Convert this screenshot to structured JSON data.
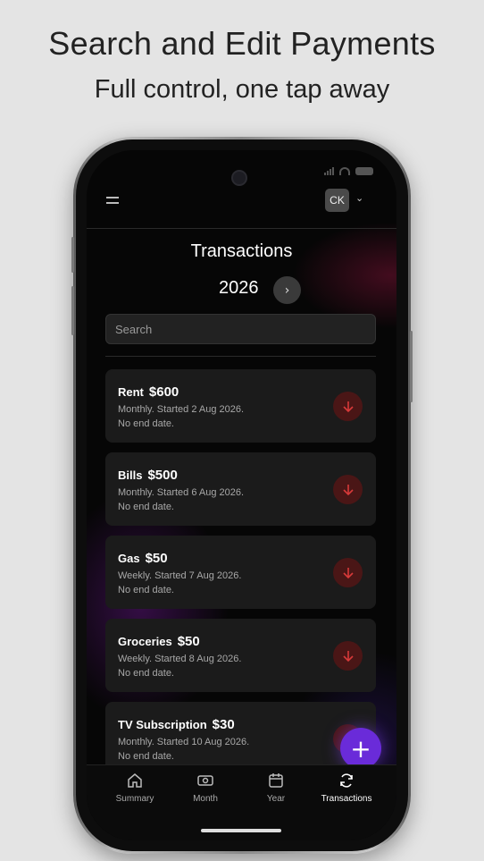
{
  "promo": {
    "headline": "Search and Edit Payments",
    "subheadline": "Full control, one tap away"
  },
  "header": {
    "menu_icon": "hamburger-icon",
    "avatar_initials": "CK",
    "avatar_chevron": "⌄"
  },
  "page": {
    "title": "Transactions",
    "year": "2026",
    "next_icon": "›"
  },
  "search": {
    "placeholder": "Search"
  },
  "transactions": [
    {
      "name": "Rent",
      "amount": "$600",
      "line1": "Monthly. Started 2 Aug 2026.",
      "line2": "No end date.",
      "icon": "arrow-down-icon"
    },
    {
      "name": "Bills",
      "amount": "$500",
      "line1": "Monthly. Started 6 Aug 2026.",
      "line2": "No end date.",
      "icon": "arrow-down-icon"
    },
    {
      "name": "Gas",
      "amount": "$50",
      "line1": "Weekly. Started 7 Aug 2026.",
      "line2": "No end date.",
      "icon": "arrow-down-icon"
    },
    {
      "name": "Groceries",
      "amount": "$50",
      "line1": "Weekly. Started 8 Aug 2026.",
      "line2": "No end date.",
      "icon": "arrow-down-icon"
    },
    {
      "name": "TV Subscription",
      "amount": "$30",
      "line1": "Monthly. Started 10 Aug 2026.",
      "line2": "No end date.",
      "icon": "arrow-down-icon"
    }
  ],
  "fab": {
    "symbol": "+"
  },
  "nav": {
    "items": [
      {
        "label": "Summary",
        "icon": "home-icon"
      },
      {
        "label": "Month",
        "icon": "money-icon"
      },
      {
        "label": "Year",
        "icon": "calendar-icon"
      },
      {
        "label": "Transactions",
        "icon": "refresh-icon",
        "active": true
      }
    ]
  },
  "colors": {
    "accent": "#6a2bd9",
    "expense": "#d83a3a",
    "card": "#1b1b1b"
  }
}
